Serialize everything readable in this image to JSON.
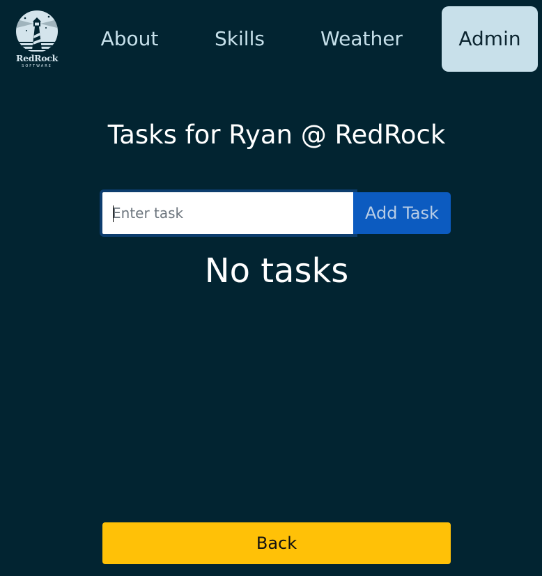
{
  "app": {
    "logo": {
      "name": "RedRock",
      "subtitle": "SOFTWARE",
      "icon": "lighthouse-logo"
    }
  },
  "nav": {
    "items": [
      {
        "label": "About",
        "active": false
      },
      {
        "label": "Skills",
        "active": false
      },
      {
        "label": "Weather",
        "active": false
      },
      {
        "label": "Admin",
        "active": true
      }
    ]
  },
  "main": {
    "title": "Tasks for Ryan @ RedRock",
    "task_input": {
      "placeholder": "Enter task",
      "value": ""
    },
    "add_button_label": "Add Task",
    "empty_message": "No tasks",
    "back_button_label": "Back"
  },
  "colors": {
    "background": "#022431",
    "active_nav": "#c8e0ea",
    "primary_button": "#0c5bc0",
    "warning_button": "#ffc107"
  }
}
